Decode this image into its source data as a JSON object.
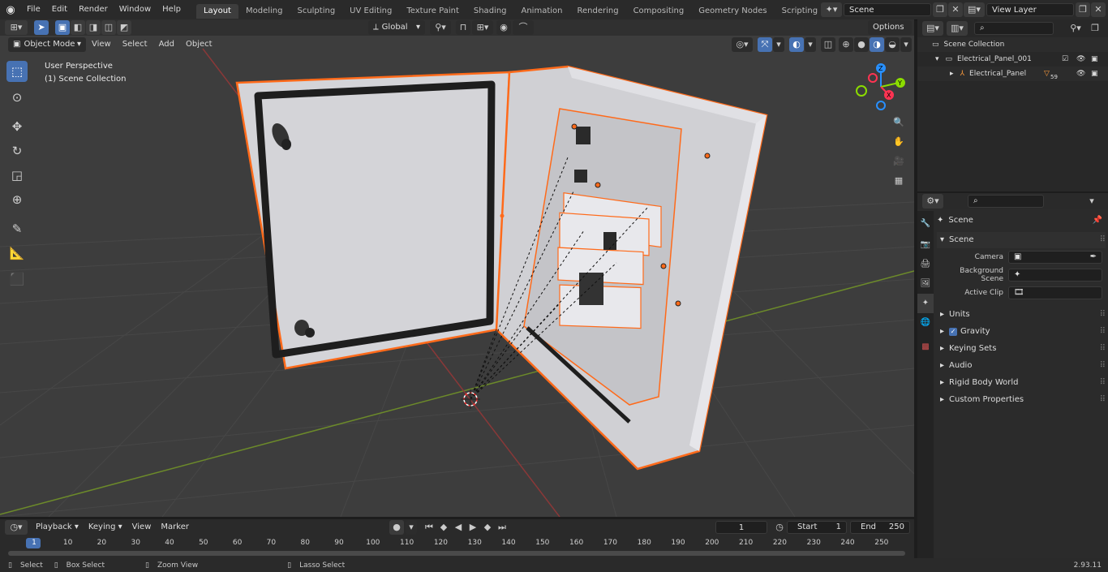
{
  "menus": [
    "File",
    "Edit",
    "Render",
    "Window",
    "Help"
  ],
  "workspaces": [
    "Layout",
    "Modeling",
    "Sculpting",
    "UV Editing",
    "Texture Paint",
    "Shading",
    "Animation",
    "Rendering",
    "Compositing",
    "Geometry Nodes",
    "Scripting"
  ],
  "active_workspace": "Layout",
  "scene_field": "Scene",
  "view_layer_field": "View Layer",
  "viewport": {
    "mode": "Object Mode",
    "menu": [
      "View",
      "Select",
      "Add",
      "Object"
    ],
    "transform_orientation": "Global",
    "options": "Options",
    "overlay_line1": "User Perspective",
    "overlay_line2": "(1) Scene Collection",
    "gizmo": {
      "x": "X",
      "y": "Y",
      "z": "Z"
    }
  },
  "outliner": {
    "root": "Scene Collection",
    "collection": "Electrical_Panel_001",
    "object": "Electrical_Panel",
    "modifier_count": "59"
  },
  "properties": {
    "context": "Scene",
    "section": "Scene",
    "camera_label": "Camera",
    "background_label": "Background Scene",
    "clip_label": "Active Clip",
    "panels": [
      "Units",
      "Gravity",
      "Keying Sets",
      "Audio",
      "Rigid Body World",
      "Custom Properties"
    ]
  },
  "timeline": {
    "menus": [
      "Playback",
      "Keying",
      "View",
      "Marker"
    ],
    "current_frame": "1",
    "start_label": "Start",
    "start_value": "1",
    "end_label": "End",
    "end_value": "250",
    "ticks": [
      "1",
      "10",
      "20",
      "30",
      "40",
      "50",
      "60",
      "70",
      "80",
      "90",
      "100",
      "110",
      "120",
      "130",
      "140",
      "150",
      "160",
      "170",
      "180",
      "190",
      "200",
      "210",
      "220",
      "230",
      "240",
      "250"
    ]
  },
  "status": {
    "select": "Select",
    "box_select": "Box Select",
    "zoom_view": "Zoom View",
    "lasso_select": "Lasso Select",
    "version": "2.93.11"
  },
  "colors": {
    "accent": "#4772b3",
    "selection": "#ff6a1a",
    "x_axis": "#ff3352",
    "y_axis": "#8bdc00",
    "z_axis": "#2890ff"
  }
}
